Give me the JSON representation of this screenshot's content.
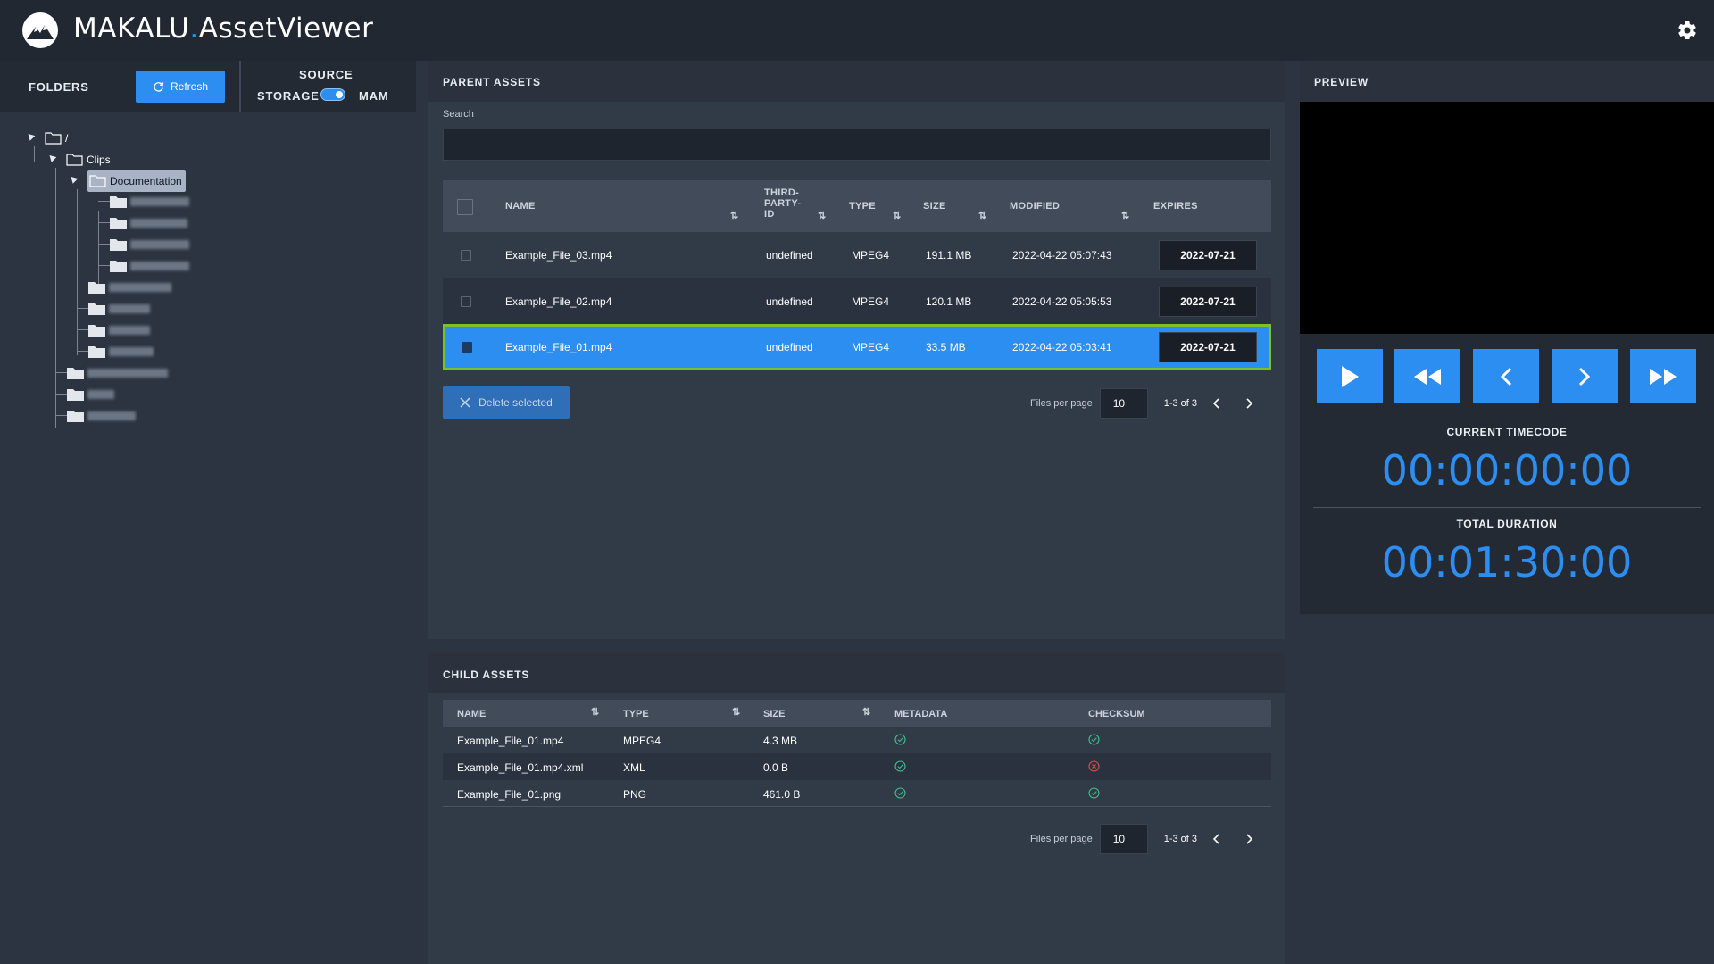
{
  "app": {
    "brand_main": "MAKALU",
    "brand_dot": ".",
    "brand_sub": "AssetViewer"
  },
  "colors": {
    "accent": "#2d8ef2",
    "selected_row": "#2d8ef2",
    "selection_outline": "#7cc12b",
    "error": "#e04a4a",
    "ok": "#3fbf8a"
  },
  "left": {
    "folders_label": "FOLDERS",
    "refresh_label": "Refresh",
    "source_label": "SOURCE",
    "storage_label": "STORAGE",
    "mam_label": "MAM",
    "tree": {
      "root": "/",
      "clips": "Clips",
      "documentation": "Documentation"
    }
  },
  "parent": {
    "title": "PARENT ASSETS",
    "search_label": "Search",
    "search_value": "",
    "columns": {
      "name": "NAME",
      "third_party": "THIRD-PARTY-ID",
      "type": "TYPE",
      "size": "SIZE",
      "modified": "MODIFIED",
      "expires": "EXPIRES"
    },
    "third_party_lines": [
      "THIRD-",
      "PARTY-",
      "ID"
    ],
    "rows": [
      {
        "name": "Example_File_03.mp4",
        "third_party": "undefined",
        "type": "MPEG4",
        "size": "191.1 MB",
        "modified": "2022-04-22 05:07:43",
        "expires": "2022-07-21",
        "selected": false
      },
      {
        "name": "Example_File_02.mp4",
        "third_party": "undefined",
        "type": "MPEG4",
        "size": "120.1 MB",
        "modified": "2022-04-22 05:05:53",
        "expires": "2022-07-21",
        "selected": false
      },
      {
        "name": "Example_File_01.mp4",
        "third_party": "undefined",
        "type": "MPEG4",
        "size": "33.5 MB",
        "modified": "2022-04-22 05:03:41",
        "expires": "2022-07-21",
        "selected": true
      }
    ],
    "delete_label": "Delete selected",
    "files_per_page_label": "Files per page",
    "files_per_page": "10",
    "range": "1-3 of 3"
  },
  "child": {
    "title": "CHILD ASSETS",
    "columns": {
      "name": "NAME",
      "type": "TYPE",
      "size": "SIZE",
      "metadata": "METADATA",
      "checksum": "CHECKSUM"
    },
    "rows": [
      {
        "name": "Example_File_01.mp4",
        "type": "MPEG4",
        "size": "4.3 MB",
        "metadata": "ok",
        "checksum": "ok"
      },
      {
        "name": "Example_File_01.mp4.xml",
        "type": "XML",
        "size": "0.0 B",
        "metadata": "ok",
        "checksum": "error"
      },
      {
        "name": "Example_File_01.png",
        "type": "PNG",
        "size": "461.0 B",
        "metadata": "ok",
        "checksum": "ok"
      }
    ],
    "files_per_page_label": "Files per page",
    "files_per_page": "10",
    "range": "1-3 of 3"
  },
  "preview": {
    "title": "PREVIEW",
    "current_label": "CURRENT TIMECODE",
    "current": "00:00:00:00",
    "total_label": "TOTAL DURATION",
    "total": "00:01:30:00",
    "controls": [
      "play-icon",
      "rewind-icon",
      "step-back-icon",
      "step-forward-icon",
      "fast-forward-icon"
    ]
  }
}
